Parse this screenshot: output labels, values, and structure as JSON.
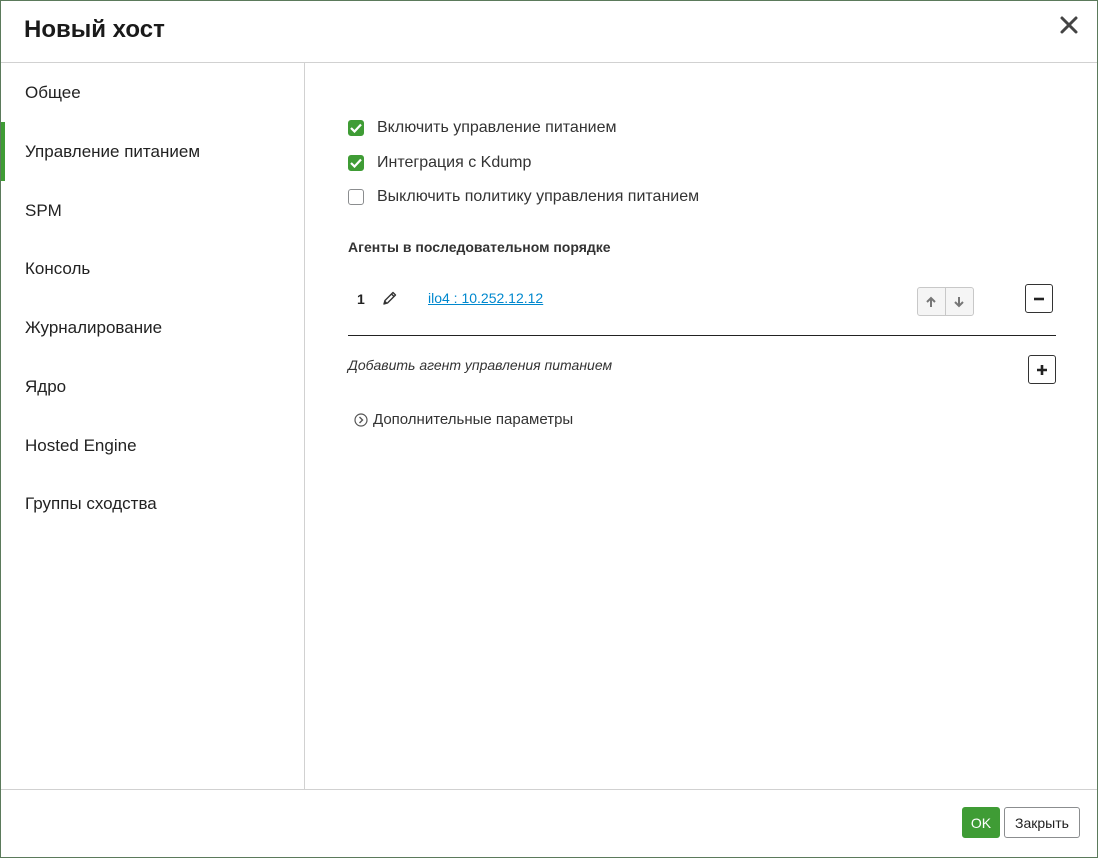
{
  "dialog": {
    "title": "Новый хост",
    "close_icon": "close-icon"
  },
  "sidebar": {
    "items": [
      {
        "label": "Общее",
        "active": false
      },
      {
        "label": "Управление питанием",
        "active": true
      },
      {
        "label": "SPM",
        "active": false
      },
      {
        "label": "Консоль",
        "active": false
      },
      {
        "label": "Журналирование",
        "active": false
      },
      {
        "label": "Ядро",
        "active": false
      },
      {
        "label": "Hosted Engine",
        "active": false
      },
      {
        "label": "Группы сходства",
        "active": false
      }
    ]
  },
  "power": {
    "checkboxes": [
      {
        "label": "Включить управление питанием",
        "checked": true
      },
      {
        "label": "Интеграция с Kdump",
        "checked": true
      },
      {
        "label": "Выключить политику управления питанием",
        "checked": false
      }
    ],
    "agents_title": "Агенты в последовательном порядке",
    "agents": [
      {
        "order": "1",
        "name": "ilo4 : 10.252.12.12"
      }
    ],
    "add_agent_label": "Добавить агент управления питанием",
    "advanced_label": "Дополнительные параметры"
  },
  "footer": {
    "ok_label": "OK",
    "close_label": "Закрыть"
  },
  "colors": {
    "accent_green": "#3f9c35",
    "link_blue": "#0088ce"
  }
}
